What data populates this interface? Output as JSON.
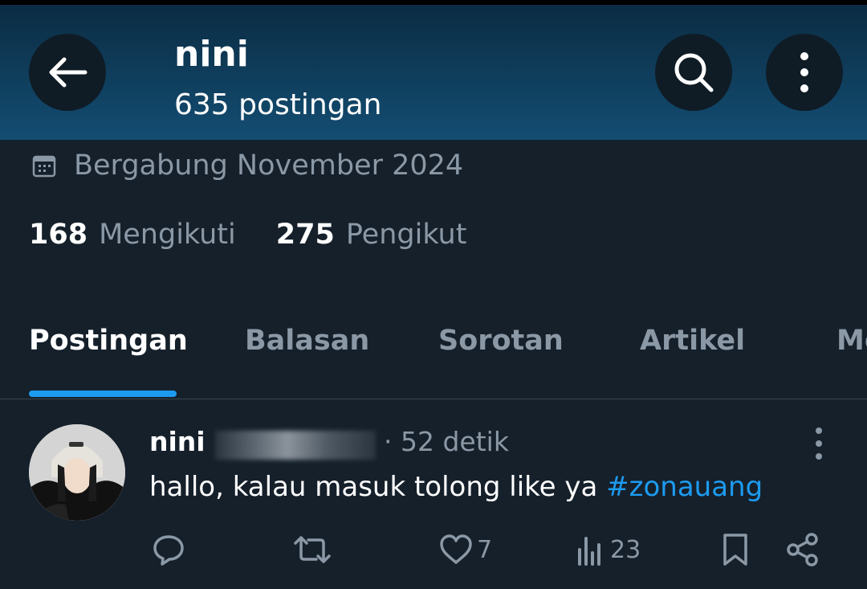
{
  "header": {
    "name": "nini",
    "post_count": "635 postingan",
    "back_icon": "arrow-left-icon",
    "search_icon": "search-icon",
    "more_icon": "more-vertical-icon"
  },
  "profile": {
    "joined_icon": "calendar-icon",
    "joined": "Bergabung November 2024",
    "following_count": "168",
    "following_label": "Mengikuti",
    "followers_count": "275",
    "followers_label": "Pengikut"
  },
  "tabs": [
    {
      "label": "Postingan",
      "active": true
    },
    {
      "label": "Balasan",
      "active": false
    },
    {
      "label": "Sorotan",
      "active": false
    },
    {
      "label": "Artikel",
      "active": false
    },
    {
      "label": "Me",
      "active": false
    }
  ],
  "post": {
    "author": "nini",
    "time": "· 52 detik",
    "text": "hallo, kalau masuk tolong like ya ",
    "hashtag": "#zonauang",
    "actions": {
      "reply_count": "",
      "repost_count": "",
      "like_count": "7",
      "views_count": "23"
    }
  },
  "colors": {
    "background": "#15202b",
    "accent": "#1d9bf0",
    "muted_text": "#8b98a5",
    "header_top": "#0b2c43",
    "header_bottom": "#134d72"
  }
}
